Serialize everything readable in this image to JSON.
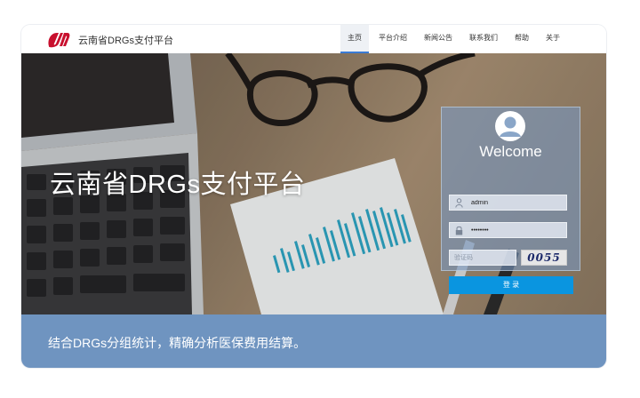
{
  "header": {
    "title": "云南省DRGs支付平台",
    "nav": [
      {
        "label": "主页",
        "active": true
      },
      {
        "label": "平台介绍",
        "active": false
      },
      {
        "label": "新闻公告",
        "active": false
      },
      {
        "label": "联系我们",
        "active": false
      },
      {
        "label": "帮助",
        "active": false
      },
      {
        "label": "关于",
        "active": false
      }
    ]
  },
  "hero": {
    "title": "云南省DRGs支付平台"
  },
  "login": {
    "welcome": "Welcome",
    "username": "admin",
    "password": "••••••••",
    "code_placeholder": "验证码",
    "captcha_text": "0055",
    "submit_label": "登 录"
  },
  "footer_band": {
    "text": "结合DRGs分组统计，精确分析医保费用结算。"
  },
  "colors": {
    "accent": "#0a95e0",
    "band": "#6f94c0",
    "logo": "#c8102e"
  },
  "icons": {
    "logo": "brand-logo",
    "avatar": "user-avatar-icon",
    "username": "user-icon",
    "password": "lock-icon"
  }
}
